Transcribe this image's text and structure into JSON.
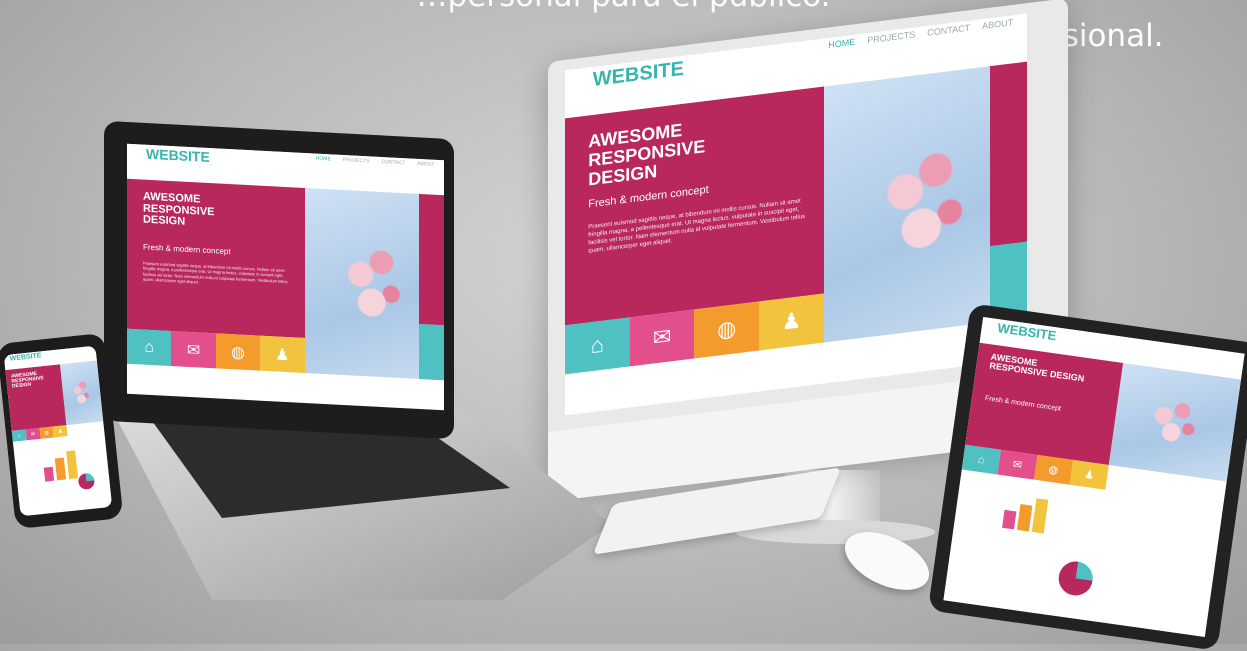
{
  "caption": {
    "top_line": "…personal para el público.",
    "tail": "profesional."
  },
  "site": {
    "logo": "WEBSITE",
    "nav": [
      "HOME",
      "PROJECTS",
      "CONTACT",
      "ABOUT"
    ],
    "headline": "AWESOME RESPONSIVE DESIGN",
    "subheadline": "Fresh & modern concept",
    "body": "Praesent euismod sagittis neque, at bibendum mi mollis cursus. Nullam sit amet fringilla magna, a pellentesque erat. Ut magna lectus, vulputate in suscipit eget, facilisis vel tortor. Nam elementum nulla id vulputate fermentum. Vestibulum tellus quam, ullamcorper eget aliquet.",
    "tiles": [
      "home-icon",
      "mail-icon",
      "globe-icon",
      "user-icon"
    ]
  },
  "colors": {
    "magenta": "#b8285d",
    "teal": "#4fc1c2",
    "pink": "#e34e8d",
    "orange": "#f39b2c",
    "yellow": "#f2c43d"
  }
}
